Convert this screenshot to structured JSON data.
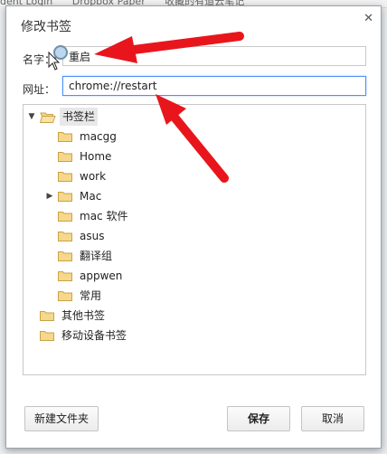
{
  "background": {
    "bar_items": [
      "dent Login",
      "Dropbox Paper",
      "收藏的有道云笔记"
    ]
  },
  "dialog": {
    "title": "修改书签",
    "name_label": "名字：",
    "name_value": "重启",
    "url_label": "网址：",
    "url_value": "chrome://restart"
  },
  "tree": {
    "root": "书签栏",
    "children": [
      "macgg",
      "Home",
      "work",
      "Mac",
      "mac 软件",
      "asus",
      "翻译组",
      "appwen",
      "常用"
    ],
    "others": [
      "其他书签",
      "移动设备书签"
    ]
  },
  "buttons": {
    "new_folder": "新建文件夹",
    "save": "保存",
    "cancel": "取消"
  },
  "colors": {
    "folder_fill": "#f5d88b",
    "folder_stroke": "#c9a24a",
    "annotation_arrow": "#e8161c"
  }
}
